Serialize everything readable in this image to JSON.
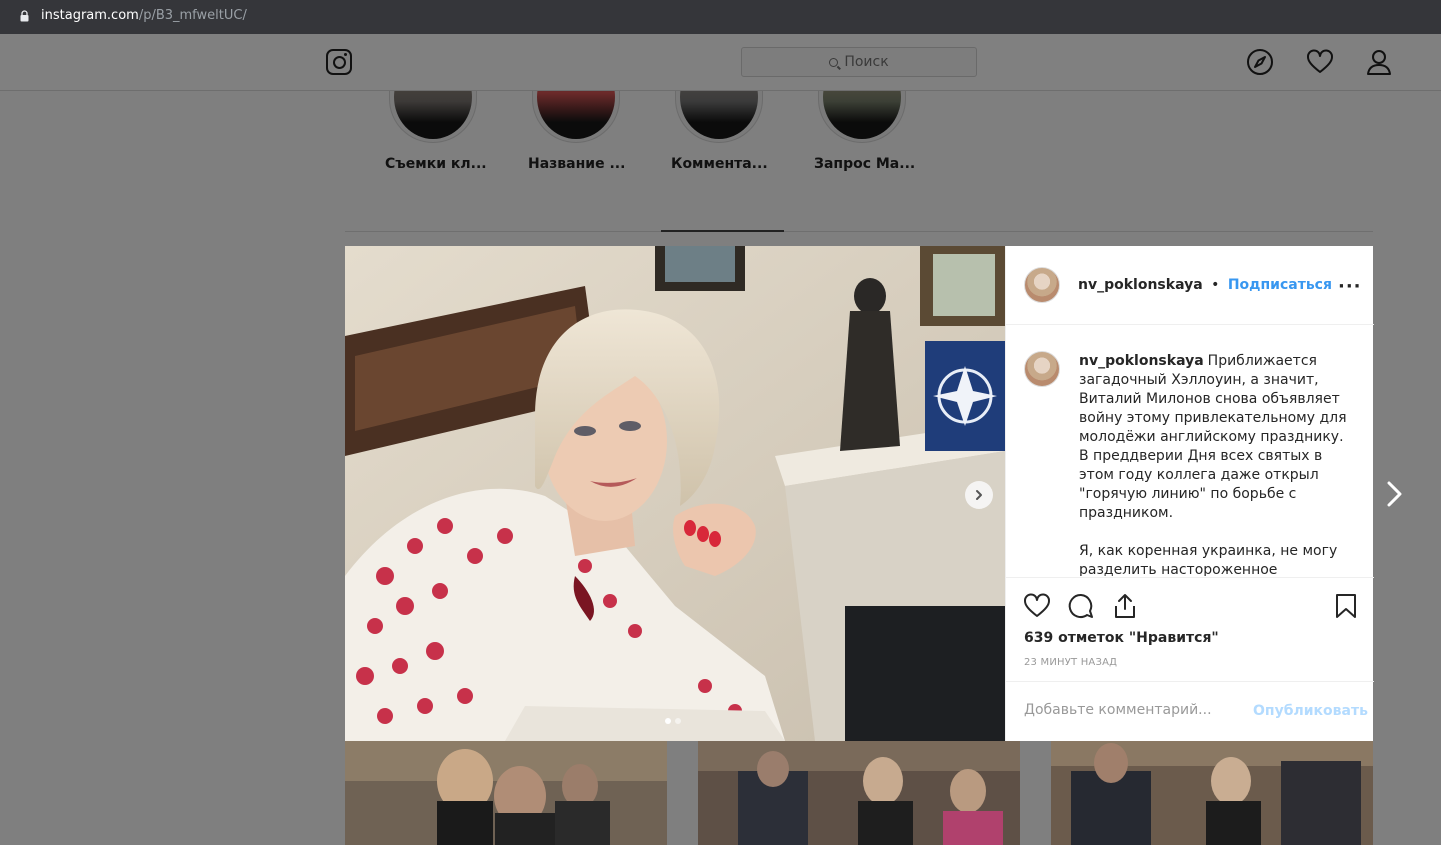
{
  "browser": {
    "url_host": "instagram.com",
    "url_path": "/p/B3_mfweltUC/"
  },
  "header": {
    "search_placeholder": "Поиск"
  },
  "highlights": [
    {
      "label": "Съемки кл..."
    },
    {
      "label": "Название ..."
    },
    {
      "label": "Коммента..."
    },
    {
      "label": "Запрос Ма..."
    }
  ],
  "post": {
    "username": "nv_poklonskaya",
    "separator": "•",
    "follow_label": "Подписаться",
    "more_label": "···",
    "caption_p1": "Приближается загадочный Хэллоуин, а значит, Виталий Милонов снова объявляет войну этому привлекательному для молодёжи английскому празднику. В преддверии Дня всех святых в этом году коллега даже открыл \"горячую линию\" по борьбе с праздником.",
    "caption_p2": "Я, как коренная украинка, не могу разделить настороженное отношение коллеги Милонова к",
    "likes": "639 отметок \"Нравится\"",
    "time": "23 минут назад",
    "comment_placeholder": "Добавьте комментарий...",
    "publish_label": "Опубликовать",
    "carousel_count": 2,
    "carousel_active": 1
  },
  "colors": {
    "link": "#3897f0",
    "publish_disabled": "#b3dbff"
  }
}
